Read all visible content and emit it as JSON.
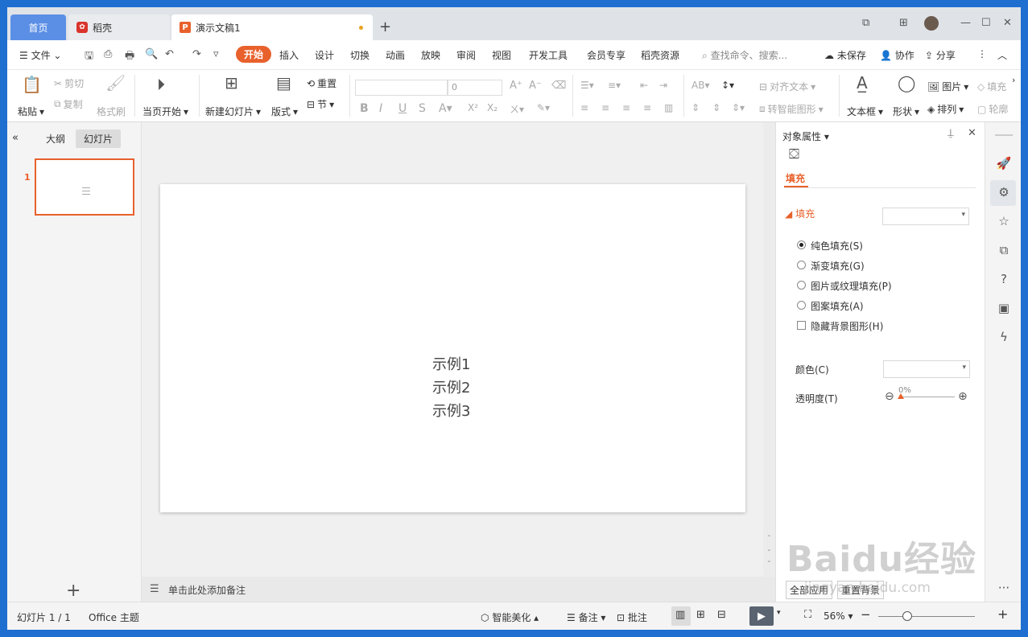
{
  "tabs": {
    "home": "首页",
    "daoke": "稻壳",
    "doc": "演示文稿1",
    "new": "+"
  },
  "menu": {
    "file": "文件",
    "items": [
      "开始",
      "插入",
      "设计",
      "切换",
      "动画",
      "放映",
      "审阅",
      "视图",
      "开发工具",
      "会员专享",
      "稻壳资源"
    ],
    "search_placeholder": "查找命令、搜索...",
    "unsaved": "未保存",
    "collab": "协作",
    "share": "分享"
  },
  "ribbon": {
    "paste": "粘贴",
    "cut": "剪切",
    "copy": "复制",
    "format_painter": "格式刷",
    "from_current": "当页开始",
    "new_slide": "新建幻灯片",
    "layout": "版式",
    "reset": "重置",
    "section": "节",
    "font_size": "0",
    "align_text": "对齐文本",
    "smart_shape": "转智能图形",
    "textbox": "文本框",
    "shape": "形状",
    "picture": "图片",
    "arrange": "排列",
    "fill": "填充",
    "outline": "轮廓"
  },
  "leftpane": {
    "outline_tab": "大纲",
    "slides_tab": "幻灯片",
    "slide_number": "1",
    "add": "+"
  },
  "slide": {
    "lines": [
      "示例1",
      "示例2",
      "示例3"
    ]
  },
  "notes": {
    "placeholder": "单击此处添加备注"
  },
  "rpane": {
    "title": "对象属性",
    "fill_tab": "填充",
    "fill_section": "填充",
    "options": [
      "纯色填充(S)",
      "渐变填充(G)",
      "图片或纹理填充(P)",
      "图案填充(A)"
    ],
    "hide_bg": "隐藏背景图形(H)",
    "color": "颜色(C)",
    "transparency": "透明度(T)",
    "transparency_value": "0%",
    "apply_all": "全部应用",
    "reset_bg": "重置背景"
  },
  "status": {
    "slide_info": "幻灯片 1 / 1",
    "theme": "Office 主题",
    "beautify": "智能美化",
    "notes": "备注",
    "comment": "批注",
    "zoom": "56%"
  },
  "watermark": {
    "brand": "Baidu经验",
    "url": "jingyan.baidu.com"
  },
  "colors": {
    "accent": "#e8612c",
    "desktop": "#1e6fd0",
    "home_tab": "#5b8fe6"
  }
}
